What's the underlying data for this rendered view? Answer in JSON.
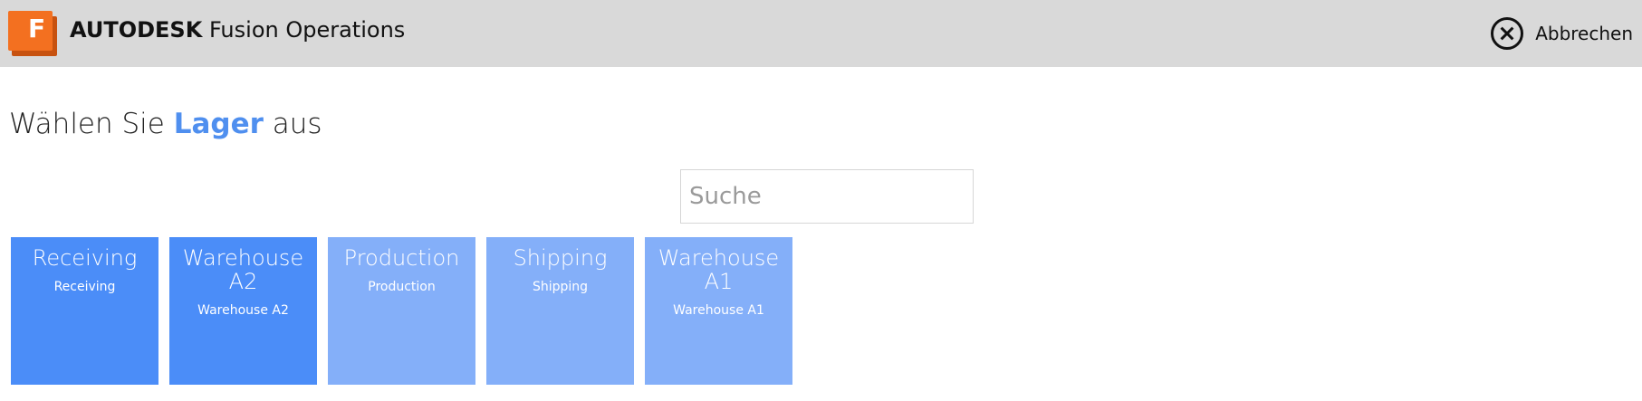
{
  "header": {
    "logo_letter": "F",
    "brand_company": "AUTODESK",
    "brand_product": "Fusion Operations",
    "cancel_label": "Abbrechen"
  },
  "main": {
    "title_prefix": "Wählen Sie",
    "title_highlight": "Lager",
    "title_suffix": "aus",
    "search_placeholder": "Suche"
  },
  "tiles": [
    {
      "name": "Receiving",
      "sub": "Receiving",
      "state": "active"
    },
    {
      "name": "Warehouse A2",
      "sub": "Warehouse A2",
      "state": "active"
    },
    {
      "name": "Production",
      "sub": "Production",
      "state": "inactive"
    },
    {
      "name": "Shipping",
      "sub": "Shipping",
      "state": "inactive"
    },
    {
      "name": "Warehouse A1",
      "sub": "Warehouse A1",
      "state": "inactive"
    }
  ],
  "colors": {
    "header_bg": "#d9d9d9",
    "logo_orange": "#f37020",
    "accent_blue": "#4f8fef",
    "tile_active": "#4b8df8",
    "tile_inactive": "#84aff9"
  }
}
